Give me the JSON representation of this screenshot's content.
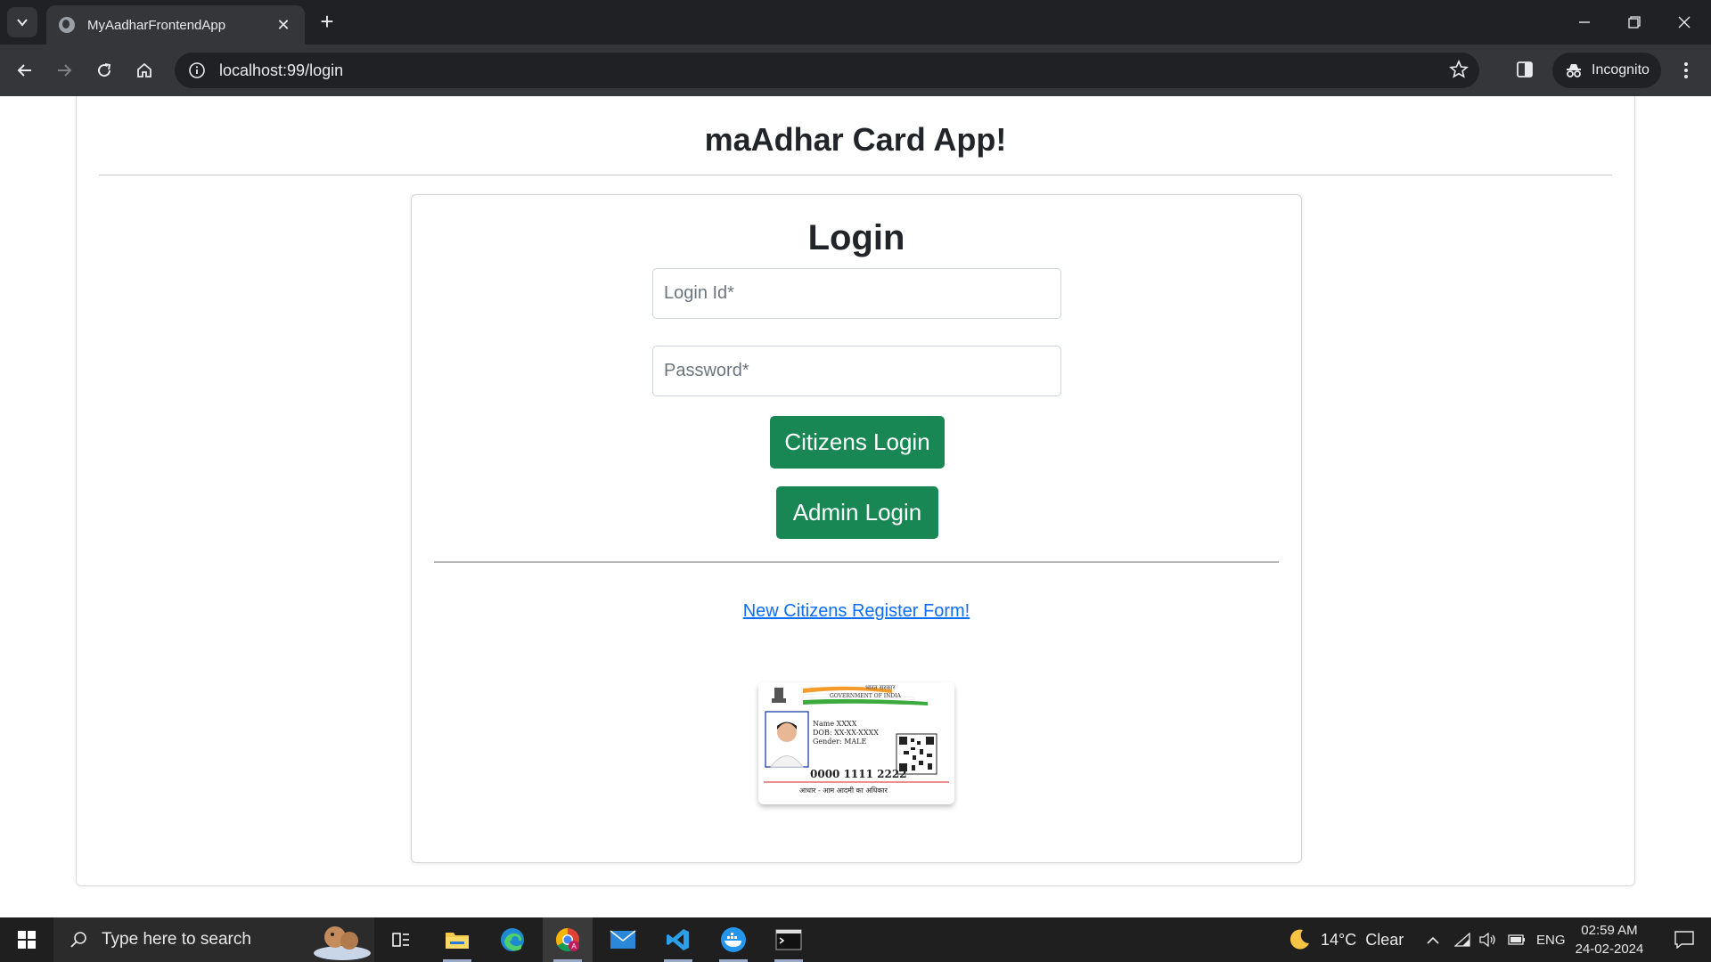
{
  "browser": {
    "tab_title": "MyAadharFrontendApp",
    "url": "localhost:99/login",
    "incognito_label": "Incognito"
  },
  "page": {
    "app_title": "maAdhar Card App!",
    "login_title": "Login",
    "login_id_placeholder": "Login Id*",
    "login_id_value": "",
    "password_placeholder": "Password*",
    "password_value": "",
    "citizens_login_label": "Citizens Login",
    "admin_login_label": "Admin Login",
    "register_link_label": "New Citizens Register Form!",
    "card_image": {
      "header_hindi": "भारत सरकार",
      "header_english": "GOVERNMENT OF INDIA",
      "name_line": "Name XXXX",
      "dob_line": "DOB: XX-XX-XXXX",
      "gender_line": "Gender: MALE",
      "number": "0000 1111 2222",
      "footer": "आधार - आम आदमी का अधिकार"
    }
  },
  "taskbar": {
    "search_placeholder": "Type here to search",
    "weather_temp": "14°C",
    "weather_desc": "Clear",
    "language": "ENG",
    "time": "02:59 AM",
    "date": "24-02-2024"
  },
  "colors": {
    "primary_button": "#198754",
    "link": "#0d6efd",
    "chrome_dark": "#202124",
    "chrome_toolbar": "#35363a"
  }
}
